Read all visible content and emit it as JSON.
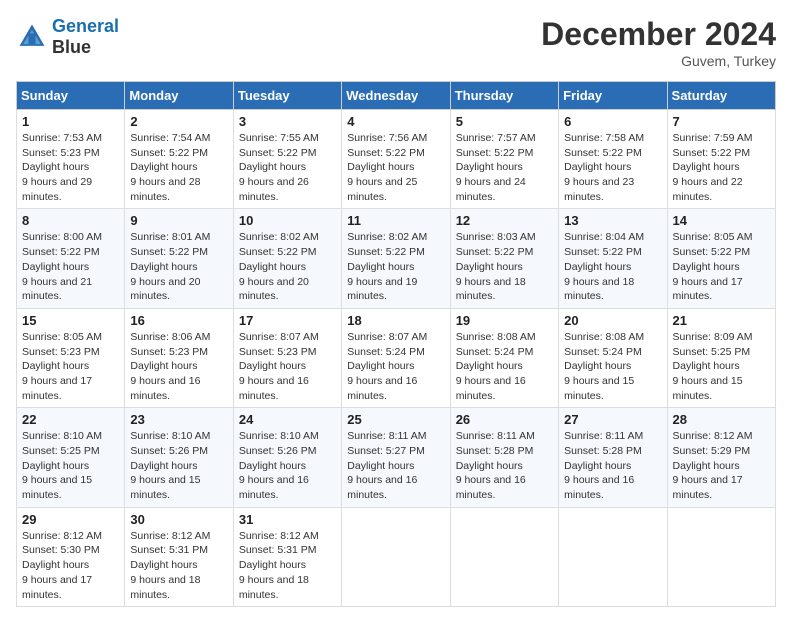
{
  "header": {
    "logo_line1": "General",
    "logo_line2": "Blue",
    "month_title": "December 2024",
    "location": "Guvem, Turkey"
  },
  "weekdays": [
    "Sunday",
    "Monday",
    "Tuesday",
    "Wednesday",
    "Thursday",
    "Friday",
    "Saturday"
  ],
  "weeks": [
    [
      {
        "day": "1",
        "sunrise": "7:53 AM",
        "sunset": "5:23 PM",
        "daylight": "9 hours and 29 minutes."
      },
      {
        "day": "2",
        "sunrise": "7:54 AM",
        "sunset": "5:22 PM",
        "daylight": "9 hours and 28 minutes."
      },
      {
        "day": "3",
        "sunrise": "7:55 AM",
        "sunset": "5:22 PM",
        "daylight": "9 hours and 26 minutes."
      },
      {
        "day": "4",
        "sunrise": "7:56 AM",
        "sunset": "5:22 PM",
        "daylight": "9 hours and 25 minutes."
      },
      {
        "day": "5",
        "sunrise": "7:57 AM",
        "sunset": "5:22 PM",
        "daylight": "9 hours and 24 minutes."
      },
      {
        "day": "6",
        "sunrise": "7:58 AM",
        "sunset": "5:22 PM",
        "daylight": "9 hours and 23 minutes."
      },
      {
        "day": "7",
        "sunrise": "7:59 AM",
        "sunset": "5:22 PM",
        "daylight": "9 hours and 22 minutes."
      }
    ],
    [
      {
        "day": "8",
        "sunrise": "8:00 AM",
        "sunset": "5:22 PM",
        "daylight": "9 hours and 21 minutes."
      },
      {
        "day": "9",
        "sunrise": "8:01 AM",
        "sunset": "5:22 PM",
        "daylight": "9 hours and 20 minutes."
      },
      {
        "day": "10",
        "sunrise": "8:02 AM",
        "sunset": "5:22 PM",
        "daylight": "9 hours and 20 minutes."
      },
      {
        "day": "11",
        "sunrise": "8:02 AM",
        "sunset": "5:22 PM",
        "daylight": "9 hours and 19 minutes."
      },
      {
        "day": "12",
        "sunrise": "8:03 AM",
        "sunset": "5:22 PM",
        "daylight": "9 hours and 18 minutes."
      },
      {
        "day": "13",
        "sunrise": "8:04 AM",
        "sunset": "5:22 PM",
        "daylight": "9 hours and 18 minutes."
      },
      {
        "day": "14",
        "sunrise": "8:05 AM",
        "sunset": "5:22 PM",
        "daylight": "9 hours and 17 minutes."
      }
    ],
    [
      {
        "day": "15",
        "sunrise": "8:05 AM",
        "sunset": "5:23 PM",
        "daylight": "9 hours and 17 minutes."
      },
      {
        "day": "16",
        "sunrise": "8:06 AM",
        "sunset": "5:23 PM",
        "daylight": "9 hours and 16 minutes."
      },
      {
        "day": "17",
        "sunrise": "8:07 AM",
        "sunset": "5:23 PM",
        "daylight": "9 hours and 16 minutes."
      },
      {
        "day": "18",
        "sunrise": "8:07 AM",
        "sunset": "5:24 PM",
        "daylight": "9 hours and 16 minutes."
      },
      {
        "day": "19",
        "sunrise": "8:08 AM",
        "sunset": "5:24 PM",
        "daylight": "9 hours and 16 minutes."
      },
      {
        "day": "20",
        "sunrise": "8:08 AM",
        "sunset": "5:24 PM",
        "daylight": "9 hours and 15 minutes."
      },
      {
        "day": "21",
        "sunrise": "8:09 AM",
        "sunset": "5:25 PM",
        "daylight": "9 hours and 15 minutes."
      }
    ],
    [
      {
        "day": "22",
        "sunrise": "8:10 AM",
        "sunset": "5:25 PM",
        "daylight": "9 hours and 15 minutes."
      },
      {
        "day": "23",
        "sunrise": "8:10 AM",
        "sunset": "5:26 PM",
        "daylight": "9 hours and 15 minutes."
      },
      {
        "day": "24",
        "sunrise": "8:10 AM",
        "sunset": "5:26 PM",
        "daylight": "9 hours and 16 minutes."
      },
      {
        "day": "25",
        "sunrise": "8:11 AM",
        "sunset": "5:27 PM",
        "daylight": "9 hours and 16 minutes."
      },
      {
        "day": "26",
        "sunrise": "8:11 AM",
        "sunset": "5:28 PM",
        "daylight": "9 hours and 16 minutes."
      },
      {
        "day": "27",
        "sunrise": "8:11 AM",
        "sunset": "5:28 PM",
        "daylight": "9 hours and 16 minutes."
      },
      {
        "day": "28",
        "sunrise": "8:12 AM",
        "sunset": "5:29 PM",
        "daylight": "9 hours and 17 minutes."
      }
    ],
    [
      {
        "day": "29",
        "sunrise": "8:12 AM",
        "sunset": "5:30 PM",
        "daylight": "9 hours and 17 minutes."
      },
      {
        "day": "30",
        "sunrise": "8:12 AM",
        "sunset": "5:31 PM",
        "daylight": "9 hours and 18 minutes."
      },
      {
        "day": "31",
        "sunrise": "8:12 AM",
        "sunset": "5:31 PM",
        "daylight": "9 hours and 18 minutes."
      },
      null,
      null,
      null,
      null
    ]
  ]
}
